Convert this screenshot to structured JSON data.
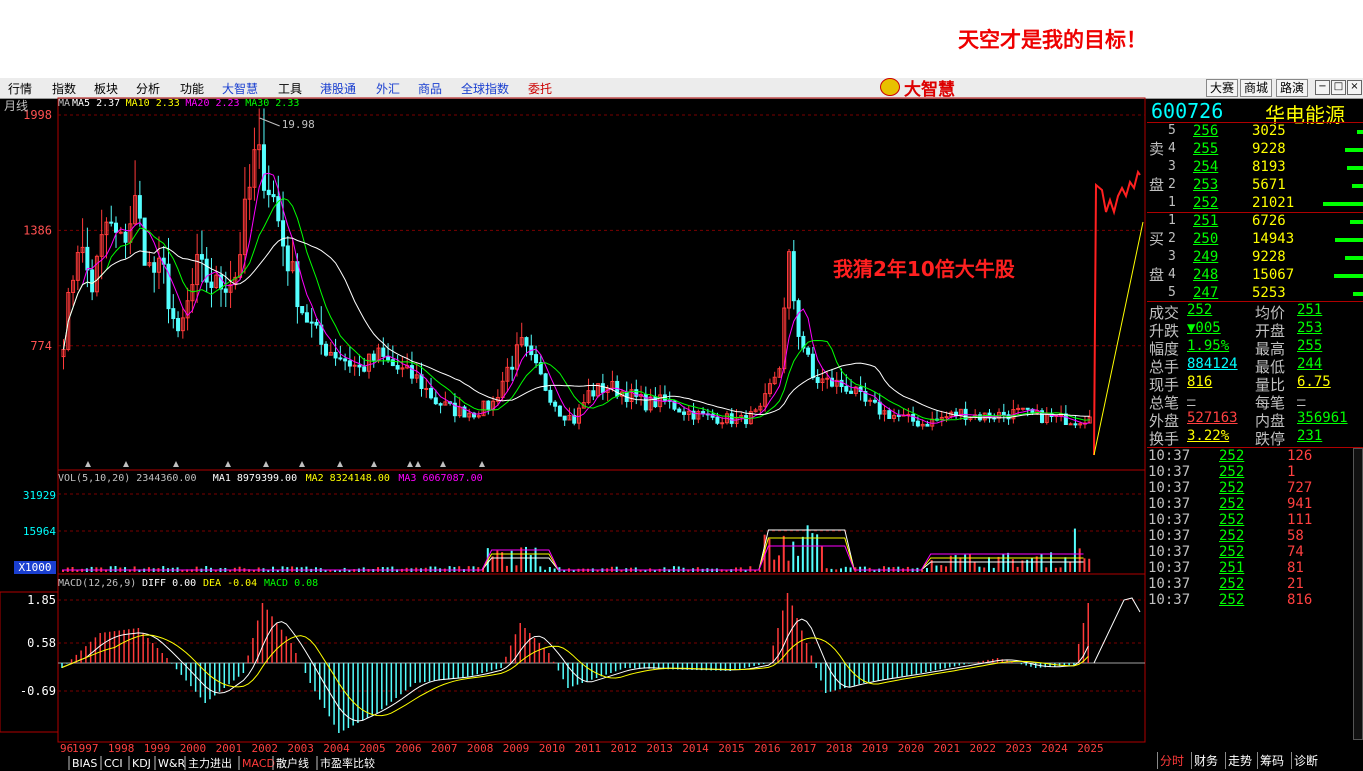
{
  "slogan": "天空才是我的目标！",
  "menu": [
    {
      "label": "行情",
      "style": "normal"
    },
    {
      "label": "指数",
      "style": "normal"
    },
    {
      "label": "板块",
      "style": "normal"
    },
    {
      "label": "分析",
      "style": "normal"
    },
    {
      "label": "功能",
      "style": "normal"
    },
    {
      "label": "大智慧",
      "style": "blue"
    },
    {
      "label": "工具",
      "style": "normal"
    },
    {
      "label": "港股通",
      "style": "blue"
    },
    {
      "label": "外汇",
      "style": "blue"
    },
    {
      "label": "商品",
      "style": "blue"
    },
    {
      "label": "全球指数",
      "style": "blue"
    },
    {
      "label": "委托",
      "style": "red"
    }
  ],
  "brand": "大智慧",
  "top_buttons": [
    "大赛",
    "商城",
    "路演"
  ],
  "window_buttons": [
    "−",
    "□",
    "×"
  ],
  "chart_data": {
    "type": "candlestick",
    "period": "月线",
    "price_panel": {
      "ma_label": "MA",
      "ma": [
        {
          "name": "MA5",
          "value": "2.37",
          "color": "#ffffff"
        },
        {
          "name": "MA10",
          "value": "2.33",
          "color": "#ffff00"
        },
        {
          "name": "MA20",
          "value": "2.23",
          "color": "#ff00ff"
        },
        {
          "name": "MA30",
          "value": "2.33",
          "color": "#00ff00"
        }
      ],
      "y_ticks": [
        "1998",
        "1386",
        "774"
      ],
      "peak_label": "19.98",
      "annotation": "我猜2年10倍大牛股"
    },
    "volume_panel": {
      "label": "VOL(5,10,20)",
      "vol": "2344360.00",
      "ma": [
        {
          "name": "MA1",
          "value": "8979399.00",
          "color": "#ffffff"
        },
        {
          "name": "MA2",
          "value": "8324148.00",
          "color": "#ffff00"
        },
        {
          "name": "MA3",
          "value": "6067087.00",
          "color": "#ff00ff"
        }
      ],
      "y_ticks": [
        "31929",
        "15964",
        "X1000"
      ]
    },
    "macd_panel": {
      "label": "MACD(12,26,9)",
      "diff": "DIFF 0.00",
      "dea": "DEA -0.04",
      "macd": "MACD 0.08",
      "y_ticks": [
        "1.85",
        "0.58",
        "-0.69"
      ]
    },
    "x_ticks": [
      "1997",
      "1998",
      "1999",
      "2000",
      "2001",
      "2002",
      "2003",
      "2004",
      "2005",
      "2006",
      "2007",
      "2008",
      "2009",
      "2010",
      "2011",
      "2012",
      "2013",
      "2014",
      "2015",
      "2016",
      "2017",
      "2018",
      "2019",
      "2020",
      "2021",
      "2022",
      "2023",
      "2024",
      "2025"
    ],
    "x_partial_label": "96",
    "anchors": [
      {
        "t": 0,
        "v": 820
      },
      {
        "t": 3,
        "v": 1330
      },
      {
        "t": 6,
        "v": 1090
      },
      {
        "t": 9,
        "v": 1420
      },
      {
        "t": 12,
        "v": 1310
      },
      {
        "t": 15,
        "v": 1520
      },
      {
        "t": 18,
        "v": 1180
      },
      {
        "t": 21,
        "v": 1150
      },
      {
        "t": 24,
        "v": 800
      },
      {
        "t": 28,
        "v": 1180
      },
      {
        "t": 32,
        "v": 1090
      },
      {
        "t": 36,
        "v": 1150
      },
      {
        "t": 40,
        "v": 1750
      },
      {
        "t": 42,
        "v": 1720
      },
      {
        "t": 44,
        "v": 1550
      },
      {
        "t": 46,
        "v": 1320
      },
      {
        "t": 50,
        "v": 970
      },
      {
        "t": 54,
        "v": 780
      },
      {
        "t": 58,
        "v": 720
      },
      {
        "t": 62,
        "v": 650
      },
      {
        "t": 66,
        "v": 720
      },
      {
        "t": 70,
        "v": 650
      },
      {
        "t": 74,
        "v": 600
      },
      {
        "t": 78,
        "v": 480
      },
      {
        "t": 82,
        "v": 430
      },
      {
        "t": 86,
        "v": 420
      },
      {
        "t": 90,
        "v": 470
      },
      {
        "t": 93,
        "v": 650
      },
      {
        "t": 96,
        "v": 770
      },
      {
        "t": 100,
        "v": 600
      },
      {
        "t": 104,
        "v": 430
      },
      {
        "t": 107,
        "v": 380
      },
      {
        "t": 110,
        "v": 520
      },
      {
        "t": 114,
        "v": 560
      },
      {
        "t": 118,
        "v": 520
      },
      {
        "t": 122,
        "v": 470
      },
      {
        "t": 126,
        "v": 480
      },
      {
        "t": 130,
        "v": 430
      },
      {
        "t": 134,
        "v": 400
      },
      {
        "t": 138,
        "v": 390
      },
      {
        "t": 142,
        "v": 380
      },
      {
        "t": 146,
        "v": 420
      },
      {
        "t": 150,
        "v": 680
      },
      {
        "t": 152,
        "v": 1200
      },
      {
        "t": 154,
        "v": 860
      },
      {
        "t": 157,
        "v": 600
      },
      {
        "t": 160,
        "v": 580
      },
      {
        "t": 164,
        "v": 560
      },
      {
        "t": 168,
        "v": 470
      },
      {
        "t": 172,
        "v": 420
      },
      {
        "t": 176,
        "v": 390
      },
      {
        "t": 180,
        "v": 360
      },
      {
        "t": 184,
        "v": 390
      },
      {
        "t": 188,
        "v": 420
      },
      {
        "t": 192,
        "v": 400
      },
      {
        "t": 196,
        "v": 410
      },
      {
        "t": 200,
        "v": 420
      },
      {
        "t": 204,
        "v": 400
      },
      {
        "t": 208,
        "v": 390
      },
      {
        "t": 212,
        "v": 380
      },
      {
        "t": 214,
        "v": 390
      },
      {
        "t": 215,
        "v": 430
      }
    ],
    "surge": {
      "from": "252",
      "to_top": "1998"
    }
  },
  "quote": {
    "code": "600726",
    "name": "华电能源",
    "sell_label": [
      "卖",
      "盘"
    ],
    "buy_label": [
      "买",
      "盘"
    ],
    "sell": [
      {
        "n": "5",
        "price": "256",
        "vol": "3025",
        "bar": 0.14
      },
      {
        "n": "4",
        "price": "255",
        "vol": "9228",
        "bar": 0.44
      },
      {
        "n": "3",
        "price": "254",
        "vol": "8193",
        "bar": 0.39
      },
      {
        "n": "2",
        "price": "253",
        "vol": "5671",
        "bar": 0.27
      },
      {
        "n": "1",
        "price": "252",
        "vol": "21021",
        "bar": 1.0
      }
    ],
    "buy": [
      {
        "n": "1",
        "price": "251",
        "vol": "6726",
        "bar": 0.32
      },
      {
        "n": "2",
        "price": "250",
        "vol": "14943",
        "bar": 0.71
      },
      {
        "n": "3",
        "price": "249",
        "vol": "9228",
        "bar": 0.44
      },
      {
        "n": "4",
        "price": "248",
        "vol": "15067",
        "bar": 0.72
      },
      {
        "n": "5",
        "price": "247",
        "vol": "5253",
        "bar": 0.25
      }
    ],
    "stats": [
      {
        "l1": "成交",
        "v1": "252",
        "c1": "#00ff00",
        "l2": "均价",
        "v2": "251",
        "c2": "#00ff00"
      },
      {
        "l1": "升跌",
        "v1": "▼005",
        "c1": "#00ff00",
        "l2": "开盘",
        "v2": "253",
        "c2": "#00ff00"
      },
      {
        "l1": "幅度",
        "v1": "1.95%",
        "c1": "#00ff00",
        "l2": "最高",
        "v2": "255",
        "c2": "#00ff00"
      },
      {
        "l1": "总手",
        "v1": "884124",
        "c1": "#00ffff",
        "l2": "最低",
        "v2": "244",
        "c2": "#00ff00"
      },
      {
        "l1": "现手",
        "v1": "816",
        "c1": "#ffff00",
        "l2": "量比",
        "v2": "6.75",
        "c2": "#ffff00"
      },
      {
        "l1": "总笔",
        "v1": "—",
        "c1": "#c0c0c0",
        "l2": "每笔",
        "v2": "—",
        "c2": "#c0c0c0"
      },
      {
        "l1": "外盘",
        "v1": "527163",
        "c1": "#ff4040",
        "l2": "内盘",
        "v2": "356961",
        "c2": "#00ff00"
      },
      {
        "l1": "换手",
        "v1": "3.22%",
        "c1": "#ffff00",
        "l2": "跌停",
        "v2": "231",
        "c2": "#00ff00"
      }
    ],
    "ticks": [
      {
        "time": "10:37",
        "price": "252",
        "vol": "126"
      },
      {
        "time": "10:37",
        "price": "252",
        "vol": "1"
      },
      {
        "time": "10:37",
        "price": "252",
        "vol": "727"
      },
      {
        "time": "10:37",
        "price": "252",
        "vol": "941"
      },
      {
        "time": "10:37",
        "price": "252",
        "vol": "111"
      },
      {
        "time": "10:37",
        "price": "252",
        "vol": "58"
      },
      {
        "time": "10:37",
        "price": "252",
        "vol": "74"
      },
      {
        "time": "10:37",
        "price": "251",
        "vol": "81"
      },
      {
        "time": "10:37",
        "price": "252",
        "vol": "21"
      },
      {
        "time": "10:37",
        "price": "252",
        "vol": "816"
      }
    ]
  },
  "bottom_tabs": [
    "BIAS",
    "CCI",
    "KDJ",
    "W&R",
    "主力进出",
    "MACD",
    "散户线",
    "市盈率比较"
  ],
  "right_tabs": [
    "分时",
    "财务",
    "走势",
    "筹码",
    "诊断"
  ]
}
